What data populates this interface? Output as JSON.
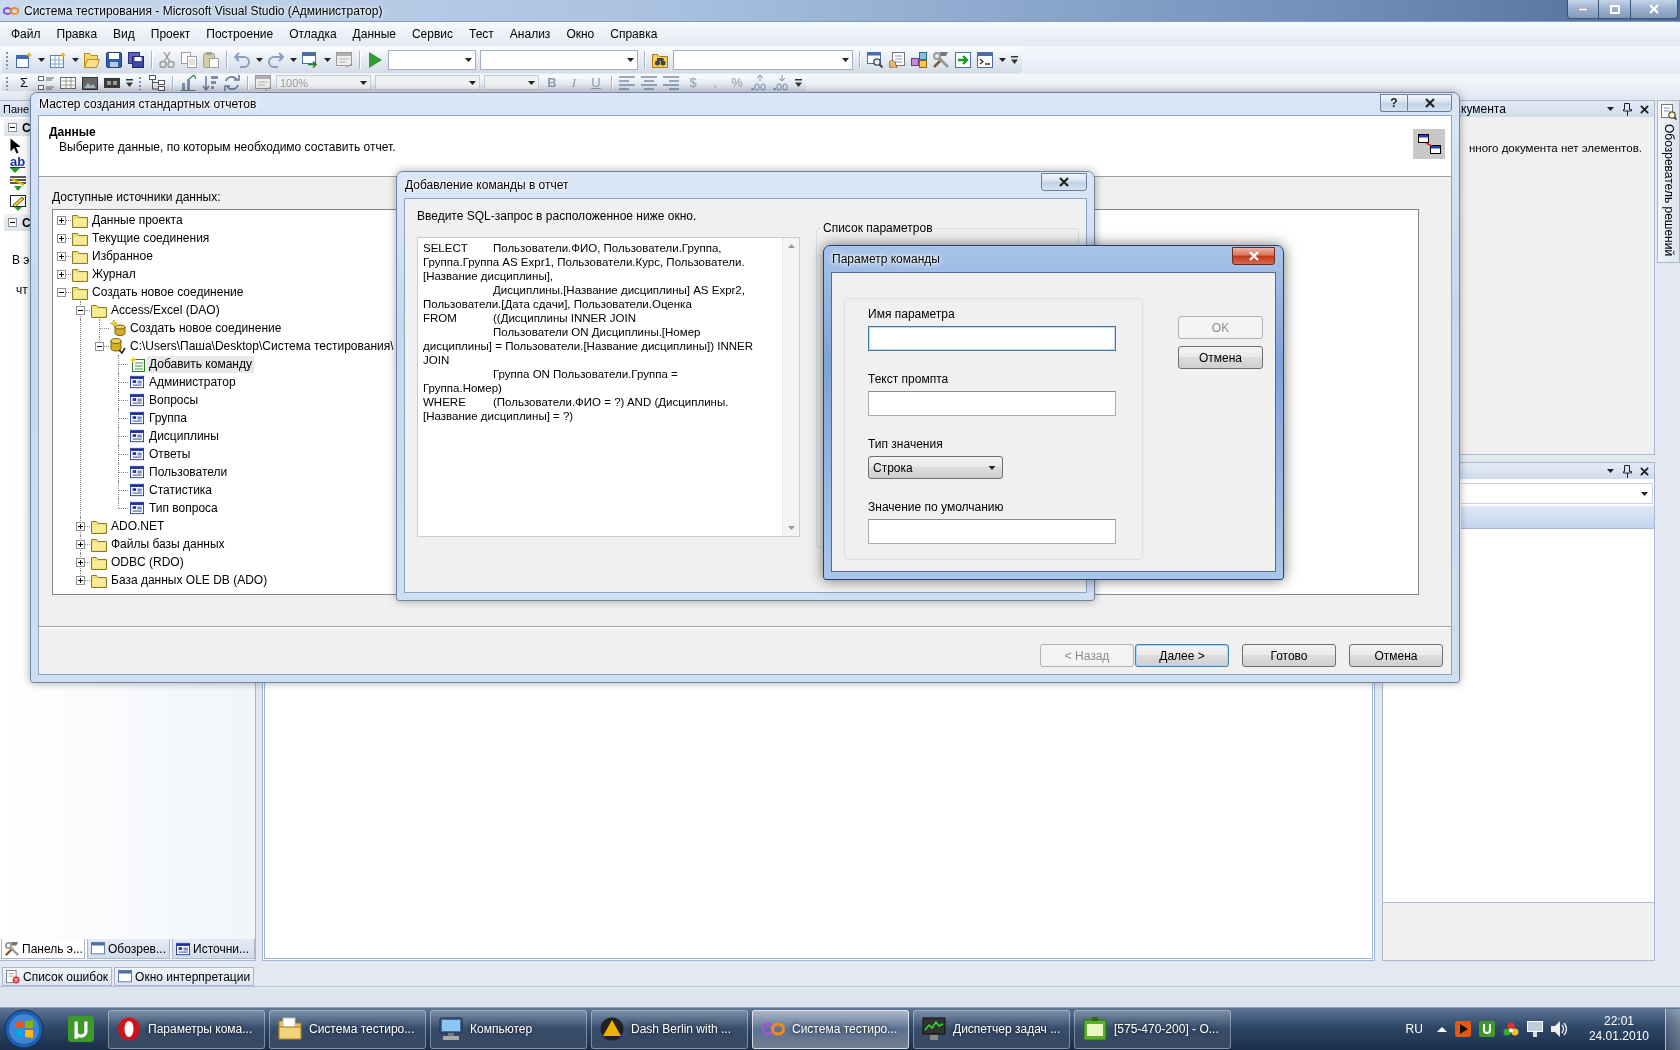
{
  "window": {
    "title": "Система тестирования - Microsoft Visual Studio (Администратор)"
  },
  "menu": [
    "Файл",
    "Правка",
    "Вид",
    "Проект",
    "Построение",
    "Отладка",
    "Данные",
    "Сервис",
    "Тест",
    "Анализ",
    "Окно",
    "Справка"
  ],
  "toolbar_1": {
    "combos": [
      {
        "disabled": false
      },
      {
        "disabled": false
      },
      {
        "disabled": false
      }
    ]
  },
  "toolbar_2": {
    "sum_label": "Σ",
    "zoom": {
      "value": "100%",
      "disabled": true
    },
    "combos": [
      {
        "disabled": true
      },
      {
        "disabled": true
      }
    ],
    "format": [
      {
        "label": "B",
        "kind": "bold",
        "disabled": true
      },
      {
        "label": "I",
        "kind": "italic",
        "disabled": true
      },
      {
        "label": "U",
        "kind": "underline",
        "disabled": true
      }
    ],
    "number_format": [
      {
        "label": "$",
        "disabled": true
      },
      {
        "label": ",",
        "disabled": true
      },
      {
        "label": "%",
        "disabled": true
      }
    ]
  },
  "toolbox": {
    "title": "Пане",
    "groups": [
      {
        "label": "С",
        "expanded": true
      },
      {
        "label": "С",
        "expanded": true
      }
    ],
    "text_tool": "ab",
    "notes": [
      "В э",
      "чт"
    ],
    "tabs": [
      {
        "label": "Панель э...",
        "selected": true
      },
      {
        "label": "Обозрев...",
        "selected": false
      },
      {
        "label": "Источни...",
        "selected": false
      }
    ]
  },
  "bottom_tabs": [
    {
      "label": "Список ошибок",
      "selected": false
    },
    {
      "label": "Окно интерпретации",
      "selected": false
    }
  ],
  "document_outline": {
    "title": "кумента",
    "message": "нного документа нет элементов."
  },
  "side_tab": {
    "label": "Обозреватель решений"
  },
  "wizard": {
    "title": "Мастер создания стандартных отчетов",
    "help": "?",
    "heading": "Данные",
    "description": "Выберите данные, по которым необходимо составить отчет.",
    "tree_label": "Доступные источники данных:",
    "tree": [
      {
        "label": "Данные проекта",
        "kind": "folder",
        "expanded": false,
        "selected": false
      },
      {
        "label": "Текущие соединения",
        "kind": "folder",
        "expanded": false,
        "selected": false
      },
      {
        "label": "Избранное",
        "kind": "folder",
        "expanded": false,
        "selected": false
      },
      {
        "label": "Журнал",
        "kind": "folder",
        "expanded": false,
        "selected": false
      },
      {
        "label": "Создать новое соединение",
        "kind": "folder",
        "expanded": true,
        "selected": false,
        "children": [
          {
            "label": "Access/Excel (DAO)",
            "kind": "folder",
            "expanded": true,
            "selected": false,
            "children": [
              {
                "label": "Создать новое соединение",
                "kind": "new_connection",
                "selected": false
              },
              {
                "label": "C:\\Users\\Паша\\Desktop\\Система тестирования\\",
                "kind": "database",
                "expanded": true,
                "selected": false,
                "children": [
                  {
                    "label": "Добавить команду",
                    "kind": "command",
                    "selected": true
                  },
                  {
                    "label": "Администратор",
                    "kind": "table",
                    "selected": false
                  },
                  {
                    "label": "Вопросы",
                    "kind": "table",
                    "selected": false
                  },
                  {
                    "label": "Группа",
                    "kind": "table",
                    "selected": false
                  },
                  {
                    "label": "Дисциплины",
                    "kind": "table",
                    "selected": false
                  },
                  {
                    "label": "Ответы",
                    "kind": "table",
                    "selected": false
                  },
                  {
                    "label": "Пользователи",
                    "kind": "table",
                    "selected": false
                  },
                  {
                    "label": "Статистика",
                    "kind": "table",
                    "selected": false
                  },
                  {
                    "label": "Тип вопроса",
                    "kind": "table",
                    "selected": false
                  }
                ]
              }
            ]
          },
          {
            "label": "ADO.NET",
            "kind": "folder",
            "expanded": false,
            "selected": false
          },
          {
            "label": "Файлы базы данных",
            "kind": "folder",
            "expanded": false,
            "selected": false
          },
          {
            "label": "ODBC (RDO)",
            "kind": "folder",
            "expanded": false,
            "selected": false
          },
          {
            "label": "База данных OLE DB (ADO)",
            "kind": "folder",
            "expanded": false,
            "selected": false
          }
        ]
      }
    ],
    "buttons": [
      {
        "label": "< Назад",
        "disabled": true,
        "default": false
      },
      {
        "label": "Далее >",
        "disabled": false,
        "default": true
      },
      {
        "label": "Готово",
        "disabled": false,
        "default": false
      },
      {
        "label": "Отмена",
        "disabled": false,
        "default": false
      }
    ]
  },
  "sql_dialog": {
    "title": "Добавление команды в отчет",
    "prompt": "Введите SQL-запрос в расположенное ниже окно.",
    "query_lines": [
      "SELECT\tПользователи.ФИО, Пользователи.Группа,",
      "Группа.Группа AS Expr1, Пользователи.Курс, Пользователи.",
      "[Название дисциплины],",
      "\tДисциплины.[Название дисциплины] AS Expr2,",
      "Пользователи.[Дата сдачи], Пользователи.Оценка",
      "FROM\t((Дисциплины INNER JOIN",
      "\tПользователи ON Дисциплины.[Номер",
      "дисциплины] = Пользователи.[Название дисциплины]) INNER",
      "JOIN",
      "\tГруппа ON Пользователи.Группа =",
      "Группа.Номер)",
      "WHERE\t(Пользователи.ФИО = ?) AND (Дисциплины.",
      "[Название дисциплины] = ?)"
    ],
    "parameters_label": "Список параметров"
  },
  "param_dialog": {
    "title": "Параметр команды",
    "fields": [
      {
        "label": "Имя параметра",
        "kind": "text",
        "focused": true
      },
      {
        "label": "Текст промпта",
        "kind": "text",
        "focused": false
      },
      {
        "label": "Тип значения",
        "kind": "select",
        "value": "Строка",
        "focused": false
      },
      {
        "label": "Значение по умолчанию",
        "kind": "text",
        "focused": false
      }
    ],
    "buttons": [
      {
        "label": "OK",
        "disabled": true
      },
      {
        "label": "Отмена",
        "disabled": false
      }
    ]
  },
  "taskbar": {
    "tasks": [
      {
        "label": "Параметры кома...",
        "kind": "browser",
        "selected": false
      },
      {
        "label": "Система тестиро...",
        "kind": "folder",
        "selected": false
      },
      {
        "label": "Компьютер",
        "kind": "computer",
        "selected": false
      },
      {
        "label": "Dash Berlin with ...",
        "kind": "player",
        "selected": false
      },
      {
        "label": "Система тестиро...",
        "kind": "studio",
        "selected": true
      },
      {
        "label": "Диспетчер задач ...",
        "kind": "monitor",
        "selected": false
      },
      {
        "label": "[575-470-200] - О...",
        "kind": "notes",
        "selected": false
      }
    ],
    "language": "RU",
    "time": "22:01",
    "date": "24.01.2010"
  }
}
